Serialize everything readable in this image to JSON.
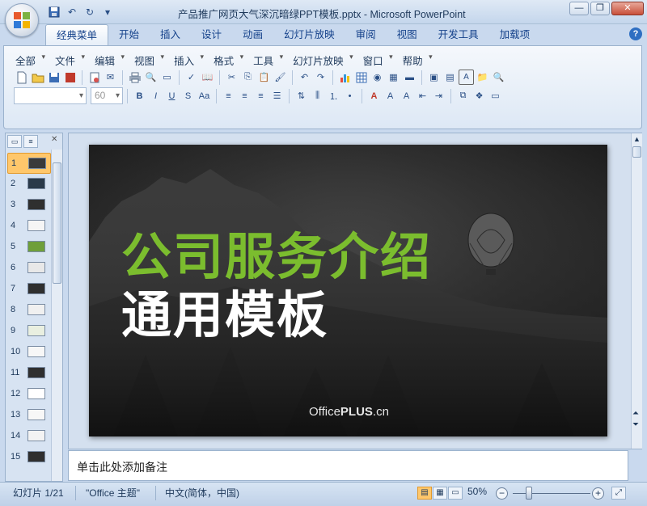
{
  "window": {
    "title": "产品推广网页大气深沉暗绿PPT模板.pptx - Microsoft PowerPoint",
    "controls": [
      "—",
      "❐",
      "✕"
    ]
  },
  "ribbon_tabs": [
    "经典菜单",
    "开始",
    "插入",
    "设计",
    "动画",
    "幻灯片放映",
    "审阅",
    "视图",
    "开发工具",
    "加载项"
  ],
  "classic_menu": [
    "全部",
    "文件",
    "编辑",
    "视图",
    "插入",
    "格式",
    "工具",
    "幻灯片放映",
    "窗口",
    "帮助"
  ],
  "font_size_combo": "60",
  "slide_thumbnails": [
    "1",
    "2",
    "3",
    "4",
    "5",
    "6",
    "7",
    "8",
    "9",
    "10",
    "11",
    "12",
    "13",
    "14",
    "15"
  ],
  "slide": {
    "title_line1": "公司服务介绍",
    "title_line2": "通用模板",
    "logo_light": "Office",
    "logo_bold": "PLUS",
    "logo_suffix": ".cn"
  },
  "notes_placeholder": "单击此处添加备注",
  "status": {
    "slide_counter": "幻灯片 1/21",
    "theme": "\"Office 主题\"",
    "language": "中文(简体，中国)",
    "zoom": "50%"
  },
  "colors": {
    "accent_green": "#7bbd2e",
    "ribbon_blue": "#15428b",
    "active_orange": "#ffc76b"
  }
}
